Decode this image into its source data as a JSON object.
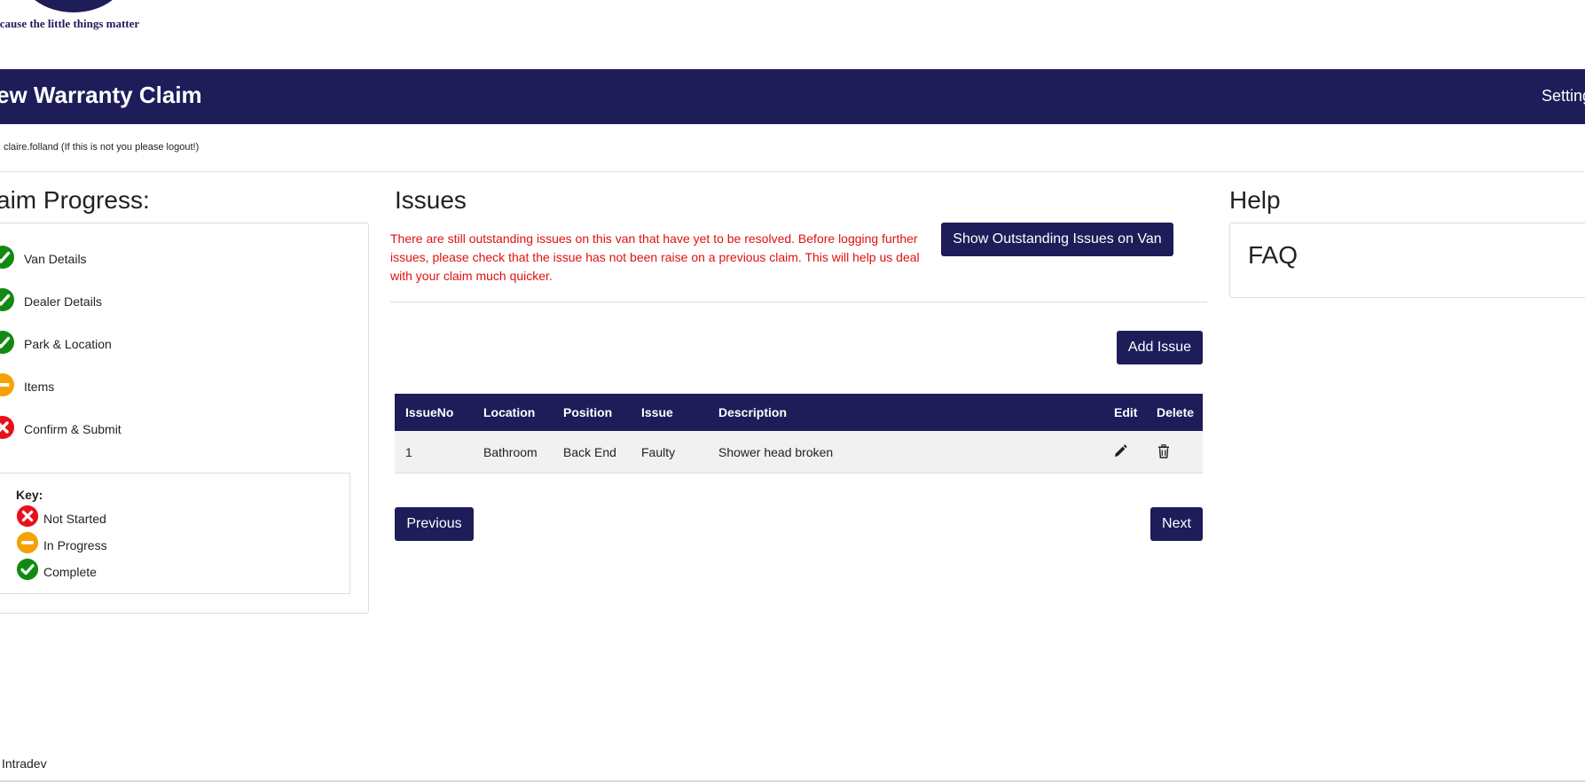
{
  "branding": {
    "tagline": "ecause the little things matter"
  },
  "header": {
    "title": "ew Warranty Claim",
    "settings": "Setting"
  },
  "user_bar": {
    "text": ": claire.folland (If this is not you please logout!)"
  },
  "progress": {
    "title": "aim Progress:",
    "steps": [
      {
        "label": "Van Details",
        "status": "complete"
      },
      {
        "label": "Dealer Details",
        "status": "complete"
      },
      {
        "label": "Park & Location",
        "status": "complete"
      },
      {
        "label": "Items",
        "status": "in-progress"
      },
      {
        "label": "Confirm & Submit",
        "status": "not-started"
      }
    ],
    "key": {
      "title": "Key:",
      "items": [
        {
          "label": "Not Started",
          "status": "not-started"
        },
        {
          "label": "In Progress",
          "status": "in-progress"
        },
        {
          "label": "Complete",
          "status": "complete"
        }
      ]
    }
  },
  "issues": {
    "title": "Issues",
    "warning": "There are still outstanding issues on this van that have yet to be resolved. Before logging further issues, please check that the issue has not been raise on a previous claim. This will help us deal with your claim much quicker.",
    "show_outstanding_button": "Show Outstanding Issues on Van",
    "add_issue_button": "Add Issue",
    "table": {
      "headers": [
        "IssueNo",
        "Location",
        "Position",
        "Issue",
        "Description",
        "Edit",
        "Delete"
      ],
      "rows": [
        {
          "issue_no": "1",
          "location": "Bathroom",
          "position": "Back End",
          "issue": "Faulty",
          "description": "Shower head broken"
        }
      ]
    },
    "previous_button": "Previous",
    "next_button": "Next"
  },
  "help": {
    "title": "Help",
    "faq_title": "FAQ"
  },
  "footer": {
    "text": "Intradev"
  },
  "colors": {
    "brand": "#1e1c59",
    "complete": "#128a12",
    "in_progress": "#f5a200",
    "not_started": "#e8101b",
    "warning_text": "#e01010"
  },
  "icons": {
    "complete": "check-circle-icon",
    "in_progress": "minus-circle-icon",
    "not_started": "x-circle-icon",
    "edit": "pencil-icon",
    "delete": "trash-icon"
  }
}
